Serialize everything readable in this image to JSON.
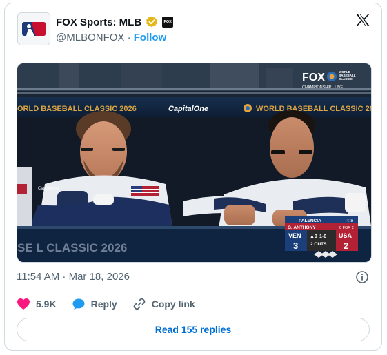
{
  "account": {
    "name": "FOX Sports: MLB",
    "handle": "@MLBONFOX",
    "separator": "·",
    "follow_label": "Follow",
    "badge_text": "FOX"
  },
  "media": {
    "broadcast_logo": "FOX",
    "wbc_logo_lines": [
      "WORLD",
      "BASEBALL",
      "CLASSIC"
    ],
    "championship_label": "CHAMPIONSHIP · LIVE",
    "banner_left": "ORLD BASEBALL CLASSIC 2026",
    "banner_sponsor": "CapitalOne",
    "banner_right": "WORLD BASEBALL CLASSIC 20",
    "bottom_banner": "SE  L CLASSIC 2026",
    "patch_text": "CapitalOne",
    "scorebug": {
      "pitcher": "PALENCIA",
      "pitch_count": "P: 8",
      "batter": "G. ANTHONY",
      "batter_stat": "0 FOR 2",
      "away_team": "VEN",
      "away_score": "3",
      "inning": "▲9",
      "count": "1-0",
      "outs": "2 OUTS",
      "home_team": "USA",
      "home_score": "2"
    }
  },
  "timestamp": "11:54 AM · Mar 18, 2026",
  "actions": {
    "likes": "5.9K",
    "reply_label": "Reply",
    "copy_label": "Copy link"
  },
  "read_replies_label": "Read 155 replies",
  "colors": {
    "accent": "#1d9bf0",
    "link_blue": "#006fd6",
    "like_pink": "#f91880",
    "verified_gold": "#e2b719"
  }
}
